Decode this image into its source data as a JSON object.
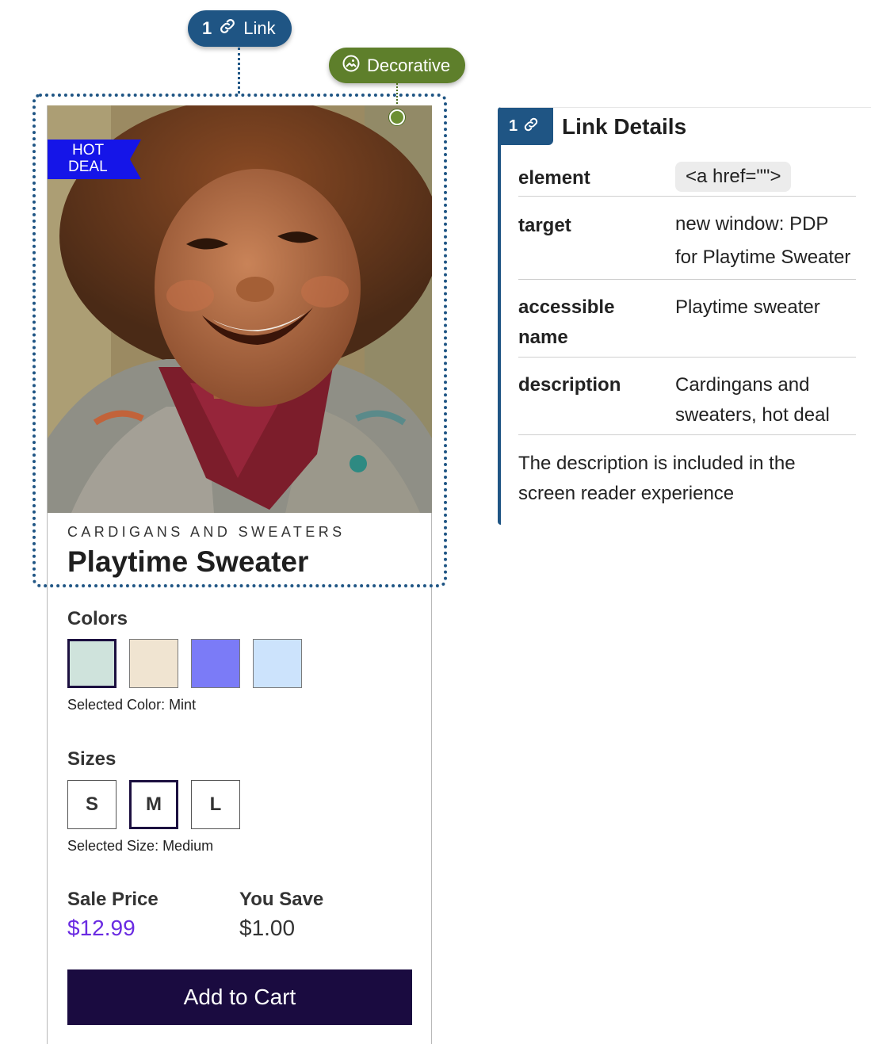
{
  "annotations": {
    "link_pill": {
      "number": "1",
      "label": "Link",
      "icon": "link-icon",
      "color": "#1f5584"
    },
    "decorative_pill": {
      "label": "Decorative",
      "icon": "image-icon",
      "color": "#5e7f2b"
    }
  },
  "product": {
    "badge": {
      "line1": "HOT",
      "line2": "DEAL",
      "color": "#1515e8"
    },
    "category": "CARDIGANS AND SWEATERS",
    "title": "Playtime Sweater",
    "colors": {
      "label": "Colors",
      "swatches": [
        {
          "name": "Mint",
          "hex": "#cfe3dc",
          "selected": true
        },
        {
          "name": "Cream",
          "hex": "#f0e4d1",
          "selected": false
        },
        {
          "name": "Periwinkle",
          "hex": "#7b7bf7",
          "selected": false
        },
        {
          "name": "Light Blue",
          "hex": "#cce3fc",
          "selected": false
        }
      ],
      "selected_text": "Selected Color: Mint"
    },
    "sizes": {
      "label": "Sizes",
      "options": [
        {
          "label": "S",
          "selected": false
        },
        {
          "label": "M",
          "selected": true
        },
        {
          "label": "L",
          "selected": false
        }
      ],
      "selected_text": "Selected Size: Medium"
    },
    "sale_price": {
      "label": "Sale Price",
      "value": "$12.99",
      "color": "#6a2be2"
    },
    "you_save": {
      "label": "You Save",
      "value": "$1.00"
    },
    "add_to_cart": "Add to Cart",
    "button_color": "#1a0b40"
  },
  "details_panel": {
    "badge_number": "1",
    "badge_icon": "link-icon",
    "title": "Link Details",
    "rows": [
      {
        "key": "element",
        "value": "<a href=\"\">"
      },
      {
        "key": "target",
        "value_line1": "new window: PDP",
        "value_line2": "for Playtime Sweater"
      },
      {
        "key_line1": "accessible",
        "key_line2": "name",
        "value": "Playtime sweater"
      },
      {
        "key": "description",
        "value_line1": "Cardingans and",
        "value_line2": "sweaters, hot deal"
      }
    ],
    "note_line1": "The description is included in the",
    "note_line2": "screen reader experience"
  }
}
